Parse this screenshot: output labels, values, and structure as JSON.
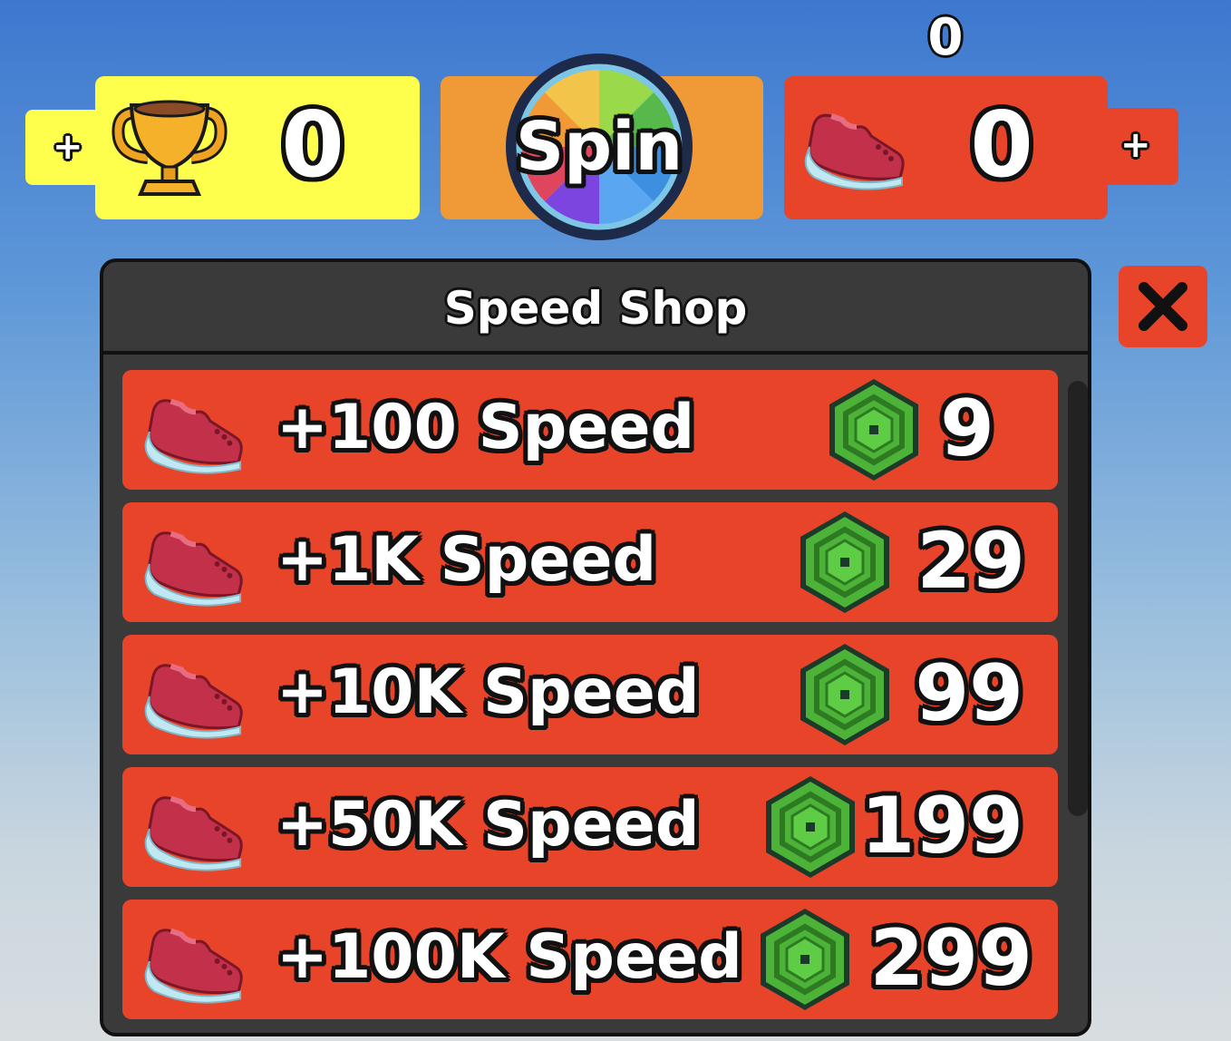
{
  "hud": {
    "trophies": {
      "plus": "+",
      "count": "0"
    },
    "spin": {
      "label": "Spin"
    },
    "speed": {
      "plus": "+",
      "count": "0",
      "top_count": "0"
    }
  },
  "shop": {
    "title": "Speed Shop",
    "close_label": "X",
    "items": [
      {
        "label": "+100 Speed",
        "price": "9"
      },
      {
        "label": "+1K Speed",
        "price": "29"
      },
      {
        "label": "+10K Speed",
        "price": "99"
      },
      {
        "label": "+50K Speed",
        "price": "199"
      },
      {
        "label": "+100K Speed",
        "price": "299"
      }
    ]
  },
  "colors": {
    "trophy_panel": "#fefe4d",
    "spin_panel": "#ef9a37",
    "speed_panel": "#e8442a",
    "shop_bg": "#3a3a3a",
    "item_bg": "#e8442a",
    "currency_green": "#4caf38"
  },
  "icons": {
    "trophy": "trophy-icon",
    "shoe": "shoe-icon",
    "currency": "robux-icon",
    "wheel": "spin-wheel-icon",
    "close": "close-icon"
  }
}
